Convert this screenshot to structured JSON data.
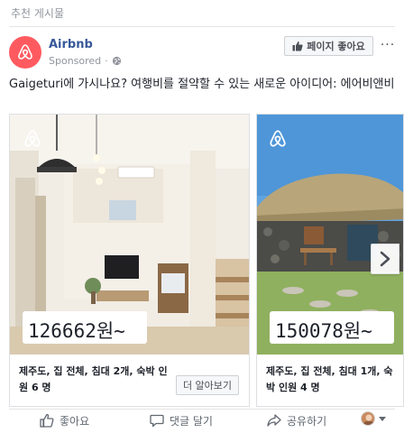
{
  "section": {
    "title": "추천 게시물"
  },
  "post": {
    "page_name": "Airbnb",
    "sponsored_label": "Sponsored",
    "like_page_label": "페이지 좋아요",
    "more_label": "···",
    "text": "Gaigeturi에 가시나요? 여행비를 절약할 수 있는 새로운 아이디어: 에어비앤비"
  },
  "carousel": {
    "cards": [
      {
        "price": "126662원~",
        "caption": "제주도, 집 전체, 침대 2개, 숙박 인원 6 명",
        "cta_label": "더 알아보기"
      },
      {
        "price": "150078원~",
        "caption": "제주도, 집 전체, 침대 1개, 숙박 인원 4 명"
      }
    ]
  },
  "actions": {
    "like_label": "좋아요",
    "comment_label": "댓글 달기",
    "share_label": "공유하기"
  },
  "colors": {
    "brand": "#ff5a5f",
    "link": "#365899",
    "muted": "#90949c",
    "border": "#dddfe2"
  },
  "icons": [
    "airbnb-logo-icon",
    "globe-icon",
    "thumbs-up-icon",
    "comment-icon",
    "share-icon",
    "chevron-right-icon",
    "caret-down-icon"
  ]
}
